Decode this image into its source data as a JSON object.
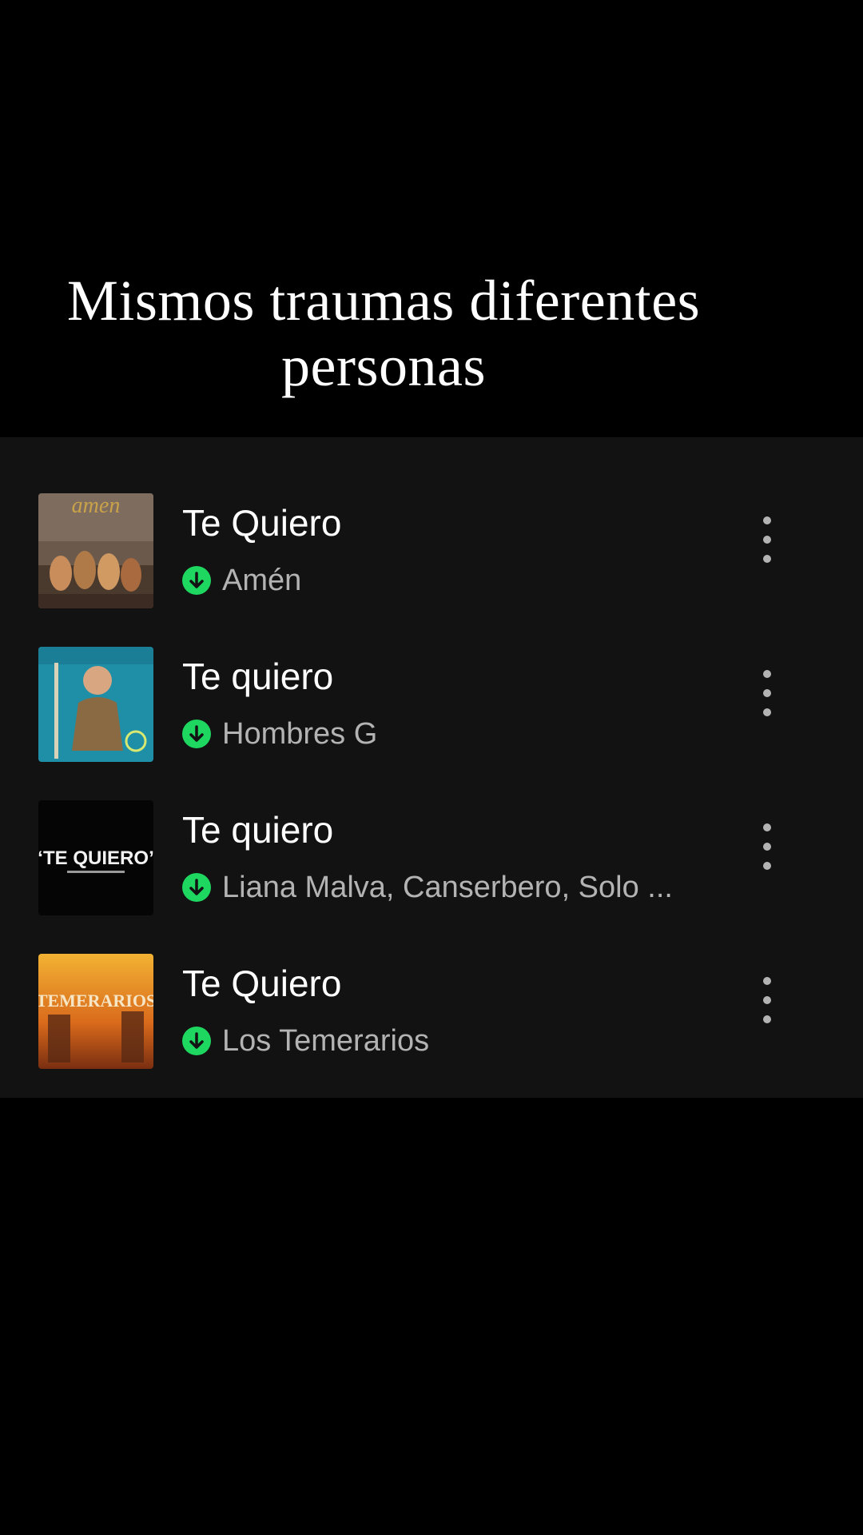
{
  "caption": {
    "line1": "Mismos traumas diferentes",
    "line2": "personas"
  },
  "tracks": [
    {
      "title": "Te Quiero",
      "artist": "Amén",
      "cover_icon": "album-cover-amen",
      "downloaded": true
    },
    {
      "title": "Te quiero",
      "artist": "Hombres G",
      "cover_icon": "album-cover-hombres-g",
      "downloaded": true
    },
    {
      "title": "Te quiero",
      "artist": "Liana Malva, Canserbero, Solo ...",
      "cover_icon": "album-cover-te-quiero",
      "cover_text": "“TE QUIERO”",
      "downloaded": true
    },
    {
      "title": "Te Quiero",
      "artist": "Los Temerarios",
      "cover_icon": "album-cover-los-temerarios",
      "cover_text": "TEMERARIOS",
      "downloaded": true
    }
  ],
  "colors": {
    "background": "#000000",
    "panel": "#121212",
    "accent_download": "#1ed760",
    "secondary_text": "#b3b3b3"
  }
}
